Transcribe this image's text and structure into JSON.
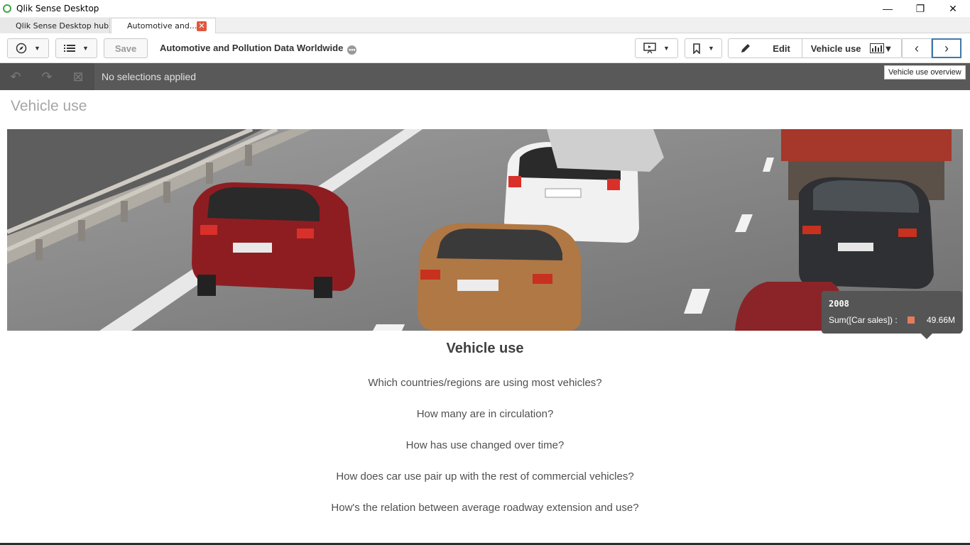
{
  "window": {
    "title": "Qlik Sense Desktop"
  },
  "tabs": [
    {
      "label": "Qlik Sense Desktop hub"
    },
    {
      "label": "Automotive and..."
    }
  ],
  "toolbar": {
    "save_label": "Save",
    "app_title": "Automotive and Pollution Data Worldwide",
    "edit_label": "Edit",
    "sheet_label": "Vehicle use"
  },
  "selections": {
    "text": "No selections applied"
  },
  "nav_tooltip": "Vehicle use overview",
  "sheet": {
    "title": "Vehicle use",
    "content_title": "Vehicle use",
    "questions": [
      "Which countries/regions are using most vehicles?",
      "How many are in circulation?",
      "How has use changed over time?",
      "How does car use pair up with the rest of commercial vehicles?",
      "How's the relation between average roadway extension and use?"
    ]
  },
  "chart_tooltip": {
    "year": "2008",
    "label": "Sum([Car sales]) :",
    "value": "49.66M",
    "swatch_color": "#e47c5d"
  }
}
